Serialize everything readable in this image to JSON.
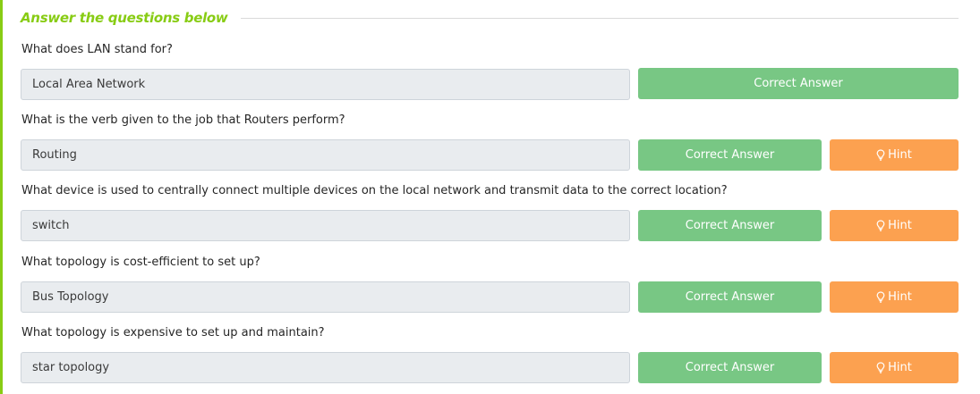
{
  "section": {
    "title": "Answer the questions below"
  },
  "questions": [
    {
      "question": "What does LAN stand for?",
      "answer": "Local Area Network",
      "correct_label": "Correct Answer",
      "has_hint": false
    },
    {
      "question": "What is the verb given to the job that Routers perform?",
      "answer": "Routing",
      "correct_label": "Correct Answer",
      "hint_label": "Hint",
      "has_hint": true
    },
    {
      "question": "What device is used to centrally connect multiple devices on the local network and transmit data to the correct location?",
      "answer": "switch",
      "correct_label": "Correct Answer",
      "hint_label": "Hint",
      "has_hint": true
    },
    {
      "question": "What topology is cost-efficient to set up?",
      "answer": "Bus Topology",
      "correct_label": "Correct Answer",
      "hint_label": "Hint",
      "has_hint": true
    },
    {
      "question": "What topology is expensive to set up and maintain?",
      "answer": "star topology",
      "correct_label": "Correct Answer",
      "hint_label": "Hint",
      "has_hint": true
    }
  ],
  "colors": {
    "accent": "#88cc14",
    "correct_button": "#78c784",
    "hint_button": "#fca150",
    "input_background": "#e9ecef"
  },
  "icons": {
    "hint": "lightbulb-icon"
  }
}
